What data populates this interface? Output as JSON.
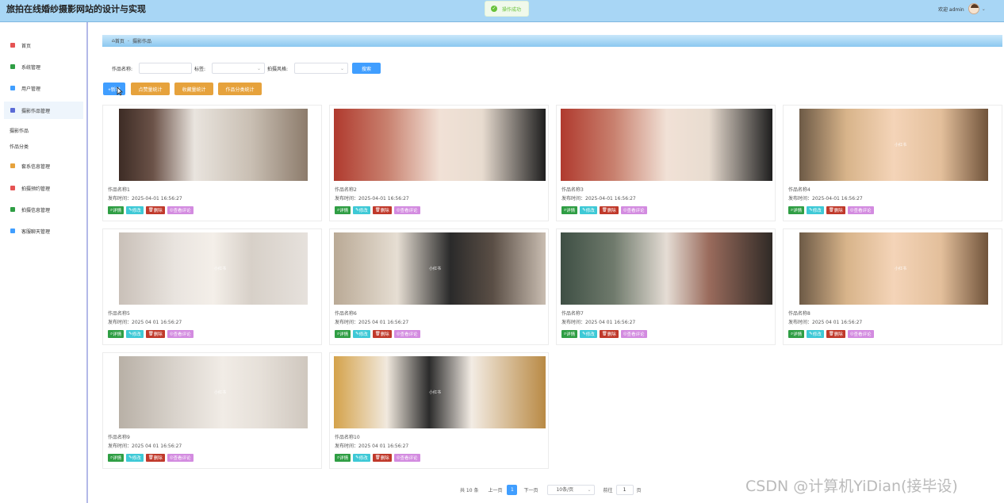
{
  "header": {
    "title": "旅拍在线婚纱摄影网站的设计与实现",
    "toast": "操作成功",
    "welcome": "欢迎 admin",
    "caret": "⌄"
  },
  "sidebar": {
    "items": [
      {
        "label": "首页",
        "icon": "home-icon",
        "color": "#e55353"
      },
      {
        "label": "系统管理",
        "icon": "gear-icon",
        "color": "#2f9e44"
      },
      {
        "label": "用户管理",
        "icon": "user-icon",
        "color": "#409eff"
      },
      {
        "label": "摄影作品管理",
        "icon": "camera-icon",
        "color": "#5b6bd6",
        "active": true
      },
      {
        "label": "套系信息管理",
        "icon": "package-icon",
        "color": "#e6a23c"
      },
      {
        "label": "拍摄预约管理",
        "icon": "calendar-icon",
        "color": "#e55353"
      },
      {
        "label": "拍摄信息管理",
        "icon": "info-icon",
        "color": "#2f9e44"
      },
      {
        "label": "客服聊天管理",
        "icon": "chat-icon",
        "color": "#409eff"
      }
    ],
    "sub_items": [
      "摄影作品",
      "作品分类"
    ]
  },
  "breadcrumb": {
    "home": "首页",
    "sep": "-",
    "current": "摄影作品"
  },
  "search": {
    "name_label": "作品名称:",
    "tag_label": "标签:",
    "style_label": "拍摄风格:",
    "button": "搜索"
  },
  "actions": {
    "add": "+新增",
    "like_stats": "点赞量统计",
    "fav_stats": "收藏量统计",
    "cat_stats": "作品分类统计"
  },
  "cards": [
    {
      "name": "作品名称1",
      "date": "发布时间：2025-04-01 16:56:27"
    },
    {
      "name": "作品名称2",
      "date": "发布时间：2025-04-01 16:56:27"
    },
    {
      "name": "作品名称3",
      "date": "发布时间：2025-04-01 16:56:27"
    },
    {
      "name": "作品名称4",
      "date": "发布时间：2025-04-01 16:56:27"
    },
    {
      "name": "作品名称5",
      "date": "发布时间：2025 04 01 16:56:27"
    },
    {
      "name": "作品名称6",
      "date": "发布时间：2025 04 01 16:56:27"
    },
    {
      "name": "作品名称7",
      "date": "发布时间：2025 04 01 16:56:27"
    },
    {
      "name": "作品名称8",
      "date": "发布时间：2025 04 01 16:56:27"
    },
    {
      "name": "作品名称9",
      "date": "发布时间：2025 04 01 16:56:27"
    },
    {
      "name": "作品名称10",
      "date": "发布时间：2025 04 01 16:56:27"
    }
  ],
  "card_ops": {
    "detail": "详情",
    "edit": "修改",
    "delete": "删除",
    "comment": "查看评论"
  },
  "photo_watermark": "小红书",
  "pagination": {
    "total": "共 10 条",
    "prev": "上一页",
    "current": "1",
    "next": "下一页",
    "page_size": "10条/页",
    "goto": "前往",
    "goto_value": "1",
    "page_unit": "页"
  },
  "watermark": "CSDN @计算机YiDian(接毕设)",
  "colors": {
    "header_bg": "#a8d6f5",
    "primary": "#409eff",
    "warning": "#e6a23c"
  }
}
